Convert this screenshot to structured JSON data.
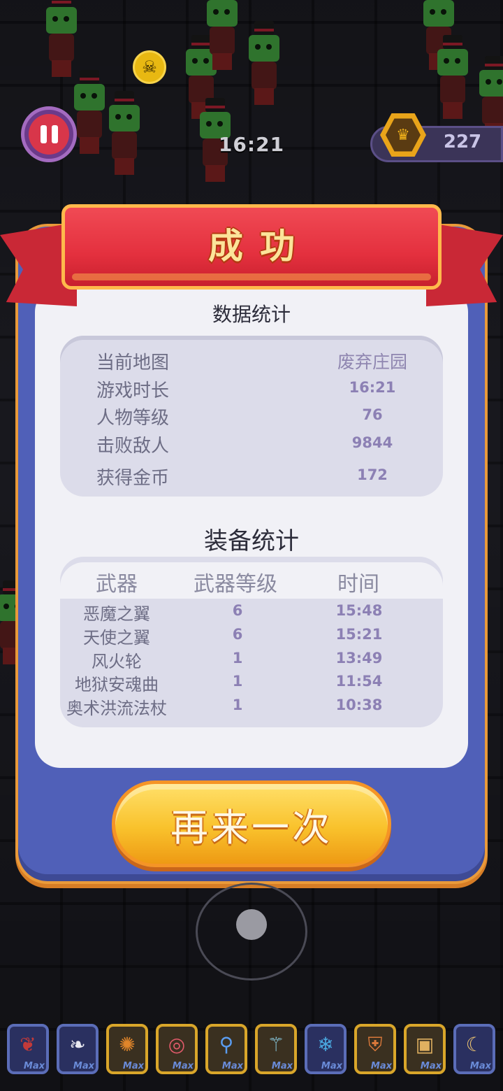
{
  "hud": {
    "timer": "16:21",
    "crowns": "227"
  },
  "result": {
    "title": "成功",
    "stats_title": "数据统计",
    "stats": [
      {
        "label": "当前地图",
        "value": "废弃庄园"
      },
      {
        "label": "游戏时长",
        "value": "16:21"
      },
      {
        "label": "人物等级",
        "value": "76"
      },
      {
        "label": "击败敌人",
        "value": "9844"
      },
      {
        "label": "获得金币",
        "value": "172"
      }
    ],
    "equip_title": "装备统计",
    "equip_headers": [
      "武器",
      "武器等级",
      "时间"
    ],
    "equipment": [
      {
        "name": "恶魔之翼",
        "level": "6",
        "time": "15:48"
      },
      {
        "name": "天使之翼",
        "level": "6",
        "time": "15:21"
      },
      {
        "name": "风火轮",
        "level": "1",
        "time": "13:49"
      },
      {
        "name": "地狱安魂曲",
        "level": "1",
        "time": "11:54"
      },
      {
        "name": "奥术洪流法杖",
        "level": "1",
        "time": "10:38"
      }
    ],
    "retry_label": "再来一次"
  },
  "slots": [
    {
      "icon": "demon-wings-icon",
      "badge": "Max",
      "style": "blue"
    },
    {
      "icon": "angel-wings-icon",
      "badge": "Max",
      "style": "blue"
    },
    {
      "icon": "fire-wheel-icon",
      "badge": "Max",
      "style": "gold"
    },
    {
      "icon": "requiem-disc-icon",
      "badge": "Max",
      "style": "gold"
    },
    {
      "icon": "orb-staff-icon",
      "badge": "Max",
      "style": "gold"
    },
    {
      "icon": "arcane-staff-icon",
      "badge": "Max",
      "style": "gold"
    },
    {
      "icon": "ice-crystal-icon",
      "badge": "Max",
      "style": "blue"
    },
    {
      "icon": "armor-icon",
      "badge": "Max",
      "style": "gold"
    },
    {
      "icon": "treasure-chest-icon",
      "badge": "Max",
      "style": "gold"
    },
    {
      "icon": "claw-icon",
      "badge": "Max",
      "style": "blue"
    }
  ],
  "colors": {
    "panel": "#5060b8",
    "panel_border": "#e99a3a",
    "ribbon": "#e4303e",
    "button": "#f9c22c"
  }
}
